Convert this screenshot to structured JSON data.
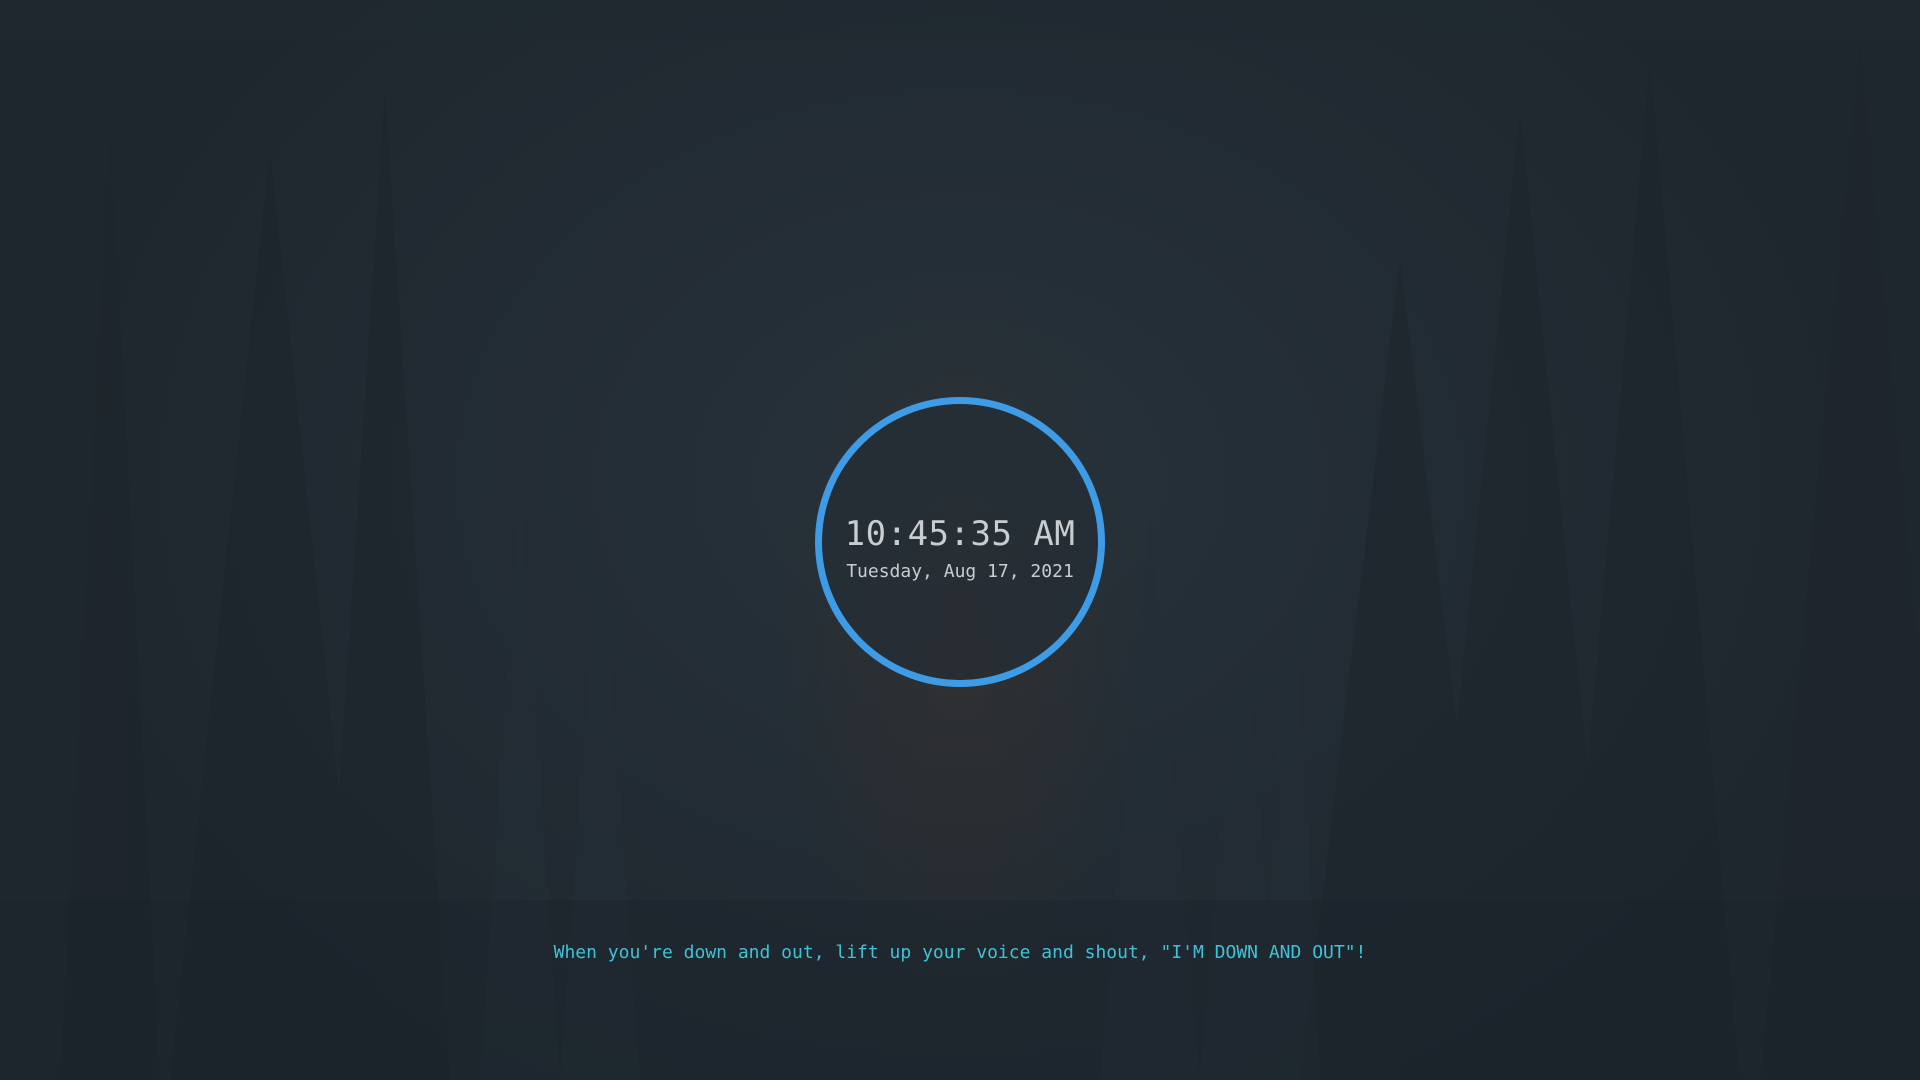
{
  "lock_screen": {
    "time": "10:45:35 AM",
    "date": "Tuesday, Aug 17, 2021",
    "quote": "When you're down and out, lift up your voice and shout, \"I'M DOWN AND OUT\"!"
  },
  "colors": {
    "background": "#222b33",
    "ring": "#3e9ce6",
    "clock_text": "#c9cdd0",
    "quote_text": "#3ec3d6"
  },
  "wallpaper": {
    "subject": "dark pine forest"
  }
}
